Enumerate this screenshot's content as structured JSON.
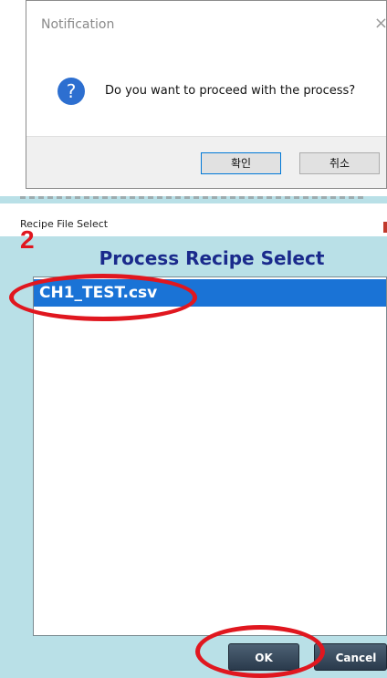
{
  "notification": {
    "title": "Notification",
    "close_glyph": "×",
    "icon": "question-icon",
    "icon_glyph": "?",
    "message": "Do you want to proceed with the process?",
    "confirm_label": "확인",
    "cancel_label": "취소"
  },
  "recipe_dialog": {
    "window_title": "Recipe File Select",
    "heading": "Process Recipe Select",
    "files": [
      {
        "name": "CH1_TEST.csv",
        "selected": true
      }
    ],
    "ok_label": "OK",
    "cancel_label": "Cancel"
  },
  "annotations": {
    "step_number": "2",
    "color": "#e0171f"
  },
  "colors": {
    "dialog_bg": "#b9e0e7",
    "selection": "#1a73d6",
    "heading": "#1a2a8c",
    "question_icon": "#2d6fd0"
  }
}
